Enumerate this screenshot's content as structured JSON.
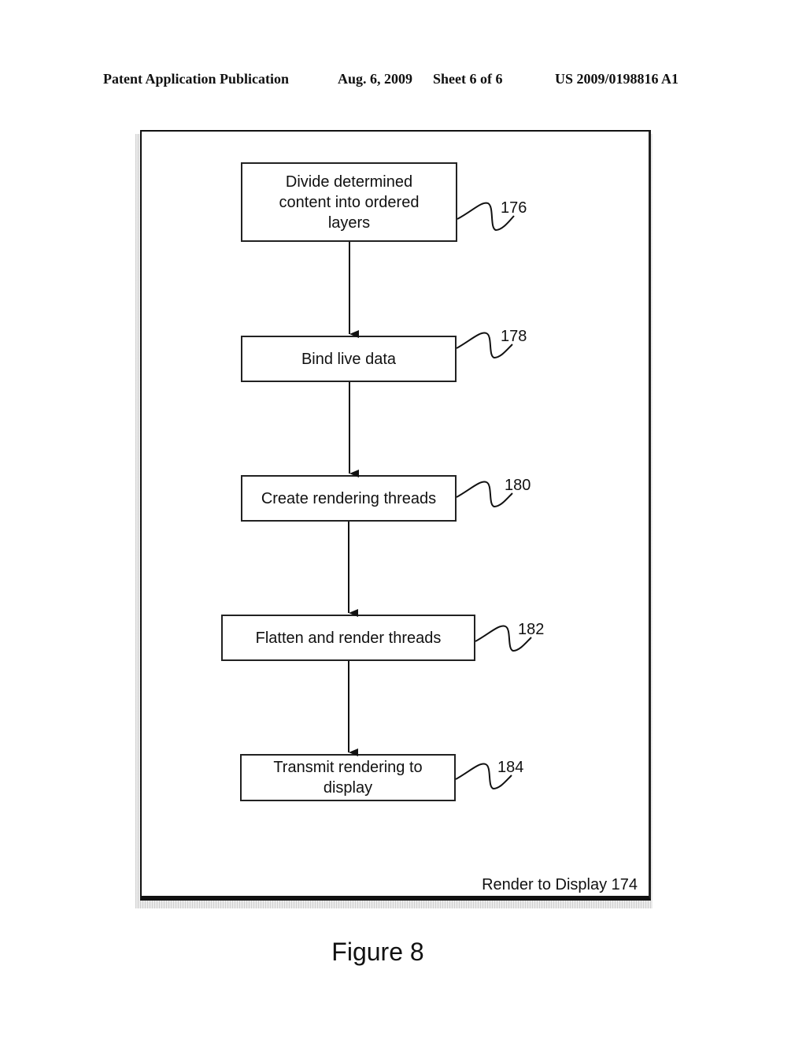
{
  "header": {
    "publication": "Patent Application Publication",
    "date": "Aug. 6, 2009",
    "sheet": "Sheet 6 of 6",
    "number": "US 2009/0198816 A1"
  },
  "frame": {
    "label": "Render to Display 174"
  },
  "steps": [
    {
      "text": "Divide determined content into ordered layers",
      "ref": "176"
    },
    {
      "text": "Bind live data",
      "ref": "178"
    },
    {
      "text": "Create rendering threads",
      "ref": "180"
    },
    {
      "text": "Flatten and render threads",
      "ref": "182"
    },
    {
      "text": "Transmit rendering to display",
      "ref": "184"
    }
  ],
  "figure": {
    "caption": "Figure 8"
  }
}
